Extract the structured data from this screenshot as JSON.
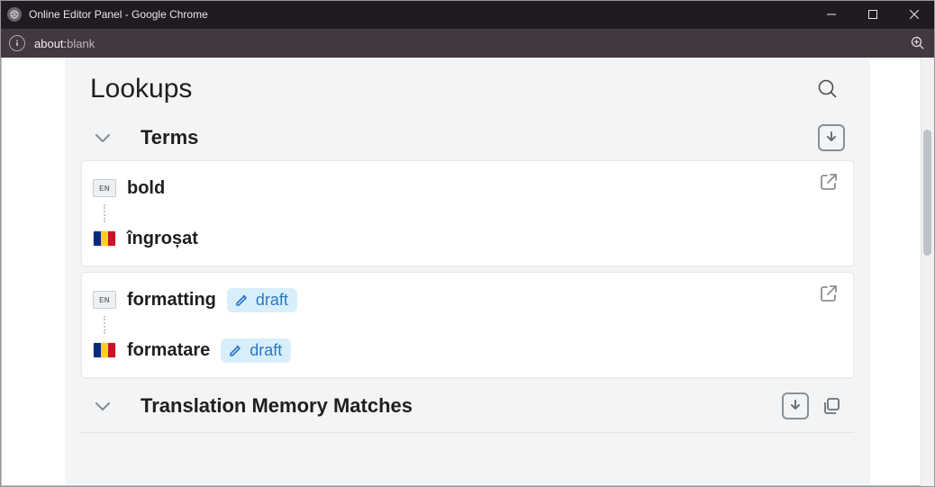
{
  "window": {
    "title": "Online Editor Panel - Google Chrome"
  },
  "address": {
    "scheme": "about:",
    "path": "blank"
  },
  "page": {
    "title": "Lookups"
  },
  "sections": {
    "terms": {
      "title": "Terms",
      "items": [
        {
          "source_lang": "EN",
          "source_text": "bold",
          "target_flag": "ro",
          "target_text": "îngroșat",
          "source_status": null,
          "target_status": null
        },
        {
          "source_lang": "EN",
          "source_text": "formatting",
          "target_flag": "ro",
          "target_text": "formatare",
          "source_status": "draft",
          "target_status": "draft"
        }
      ]
    },
    "tm": {
      "title": "Translation Memory Matches"
    }
  },
  "labels": {
    "draft": "draft"
  }
}
